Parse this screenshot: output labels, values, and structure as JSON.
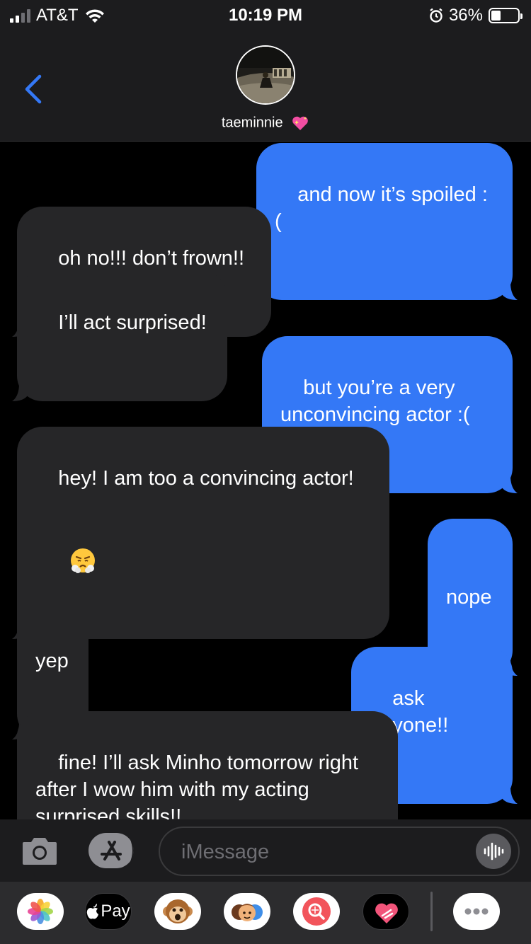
{
  "status_bar": {
    "carrier": "AT&T",
    "time": "10:19 PM",
    "battery_percent": "36%",
    "battery_level": 0.36,
    "signal_bars_on": 2,
    "signal_bars_total": 4
  },
  "header": {
    "contact_name": "taeminnie",
    "contact_emoji": "sparkling-heart-icon"
  },
  "messages": [
    {
      "direction": "sent",
      "text": "and now it’s spoiled :("
    },
    {
      "direction": "received",
      "text": "oh no!!! don’t frown!!"
    },
    {
      "direction": "received",
      "text": "I’ll act surprised!"
    },
    {
      "direction": "sent",
      "text": "but you’re a very\nunconvincing actor :("
    },
    {
      "direction": "received",
      "text": "hey! I am too a convincing actor!",
      "emoji": "face-with-steam-icon"
    },
    {
      "direction": "sent",
      "text": "nope"
    },
    {
      "direction": "received",
      "text": "yep"
    },
    {
      "direction": "sent",
      "text": "ask anyone!!"
    },
    {
      "direction": "received",
      "text": "fine! I’ll ask Minho tomorrow right\nafter I wow him with my acting\nsurprised skills!!"
    }
  ],
  "input": {
    "placeholder": "iMessage"
  },
  "drawer": {
    "apps": [
      "photos-icon",
      "apple-pay-icon",
      "animoji-icon",
      "memoji-icon",
      "images-search-icon",
      "digital-touch-icon",
      "more-icon"
    ],
    "apple_pay_label": "Pay"
  },
  "colors": {
    "sent_bubble": "#3478f6",
    "received_bubble": "#262628",
    "bar_background": "#1c1c1e"
  }
}
